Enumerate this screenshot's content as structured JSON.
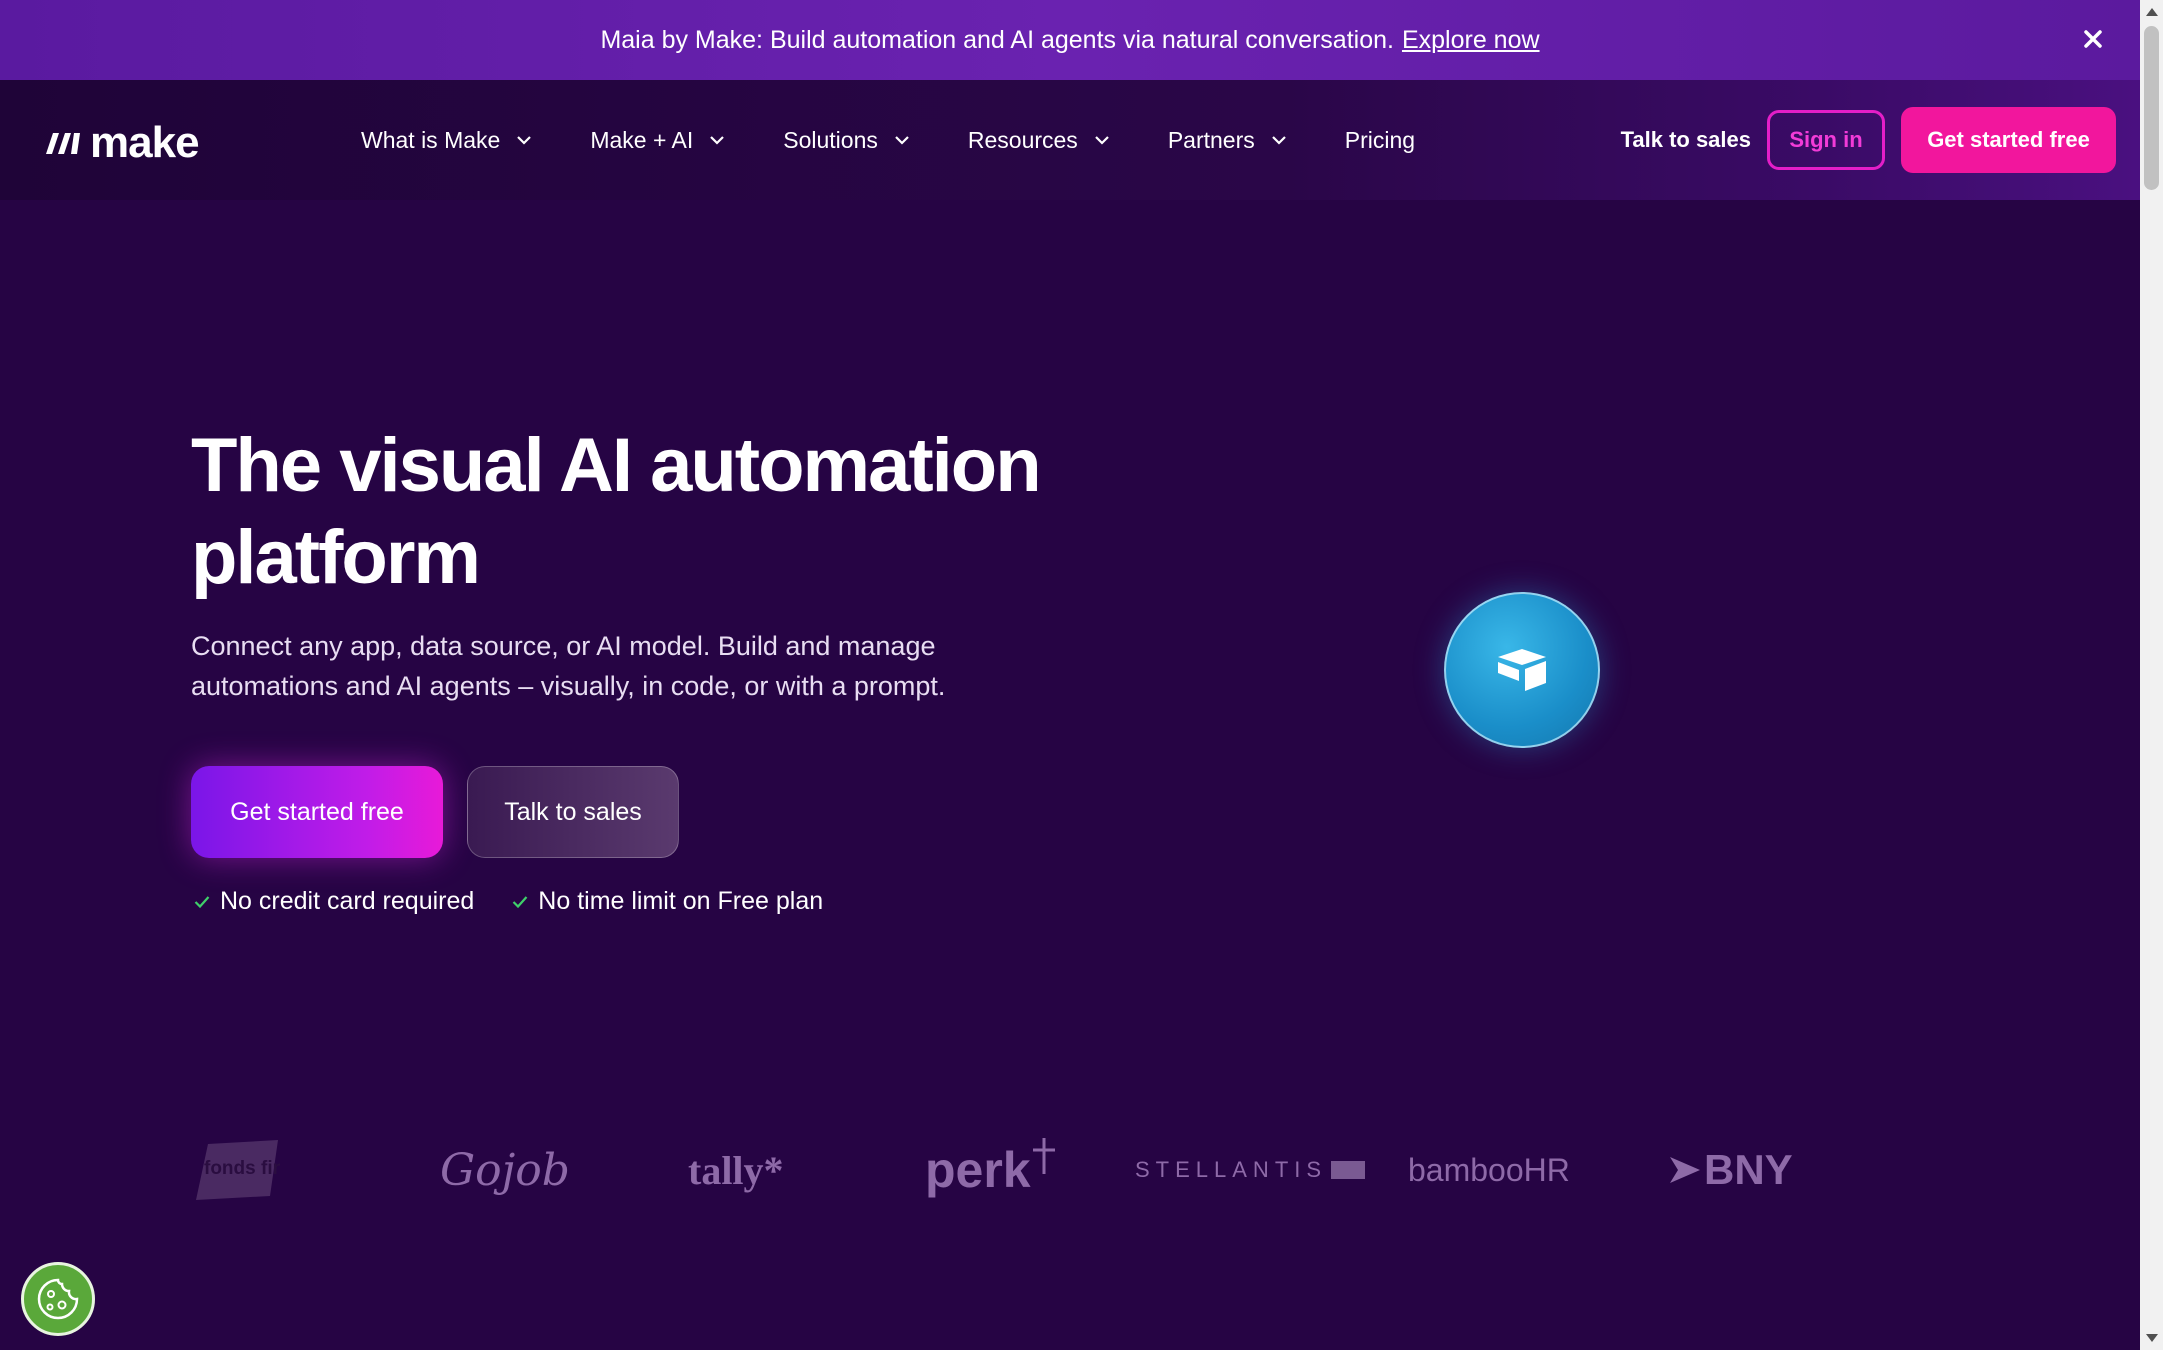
{
  "banner": {
    "text": "Maia by Make: Build automation and AI agents via natural conversation.",
    "link": "Explore now",
    "close_icon": "close-icon"
  },
  "nav": {
    "logo_text": "make",
    "menu": [
      {
        "label": "What is Make"
      },
      {
        "label": "Make + AI"
      },
      {
        "label": "Solutions"
      },
      {
        "label": "Resources"
      },
      {
        "label": "Partners"
      },
      {
        "label": "Pricing"
      }
    ],
    "talk_to_sales": "Talk to sales",
    "sign_in": "Sign in",
    "get_started": "Get started free"
  },
  "hero": {
    "title_line1": "The visual AI automation",
    "title_line2": "platform",
    "subtitle_line1": "Connect any app, data source, or AI model. Build and manage",
    "subtitle_line2": "automations and AI agents – visually, in code, or with a prompt.",
    "cta_primary": "Get started free",
    "cta_secondary": "Talk to sales",
    "checks": [
      "No credit card required",
      "No time limit on Free plan"
    ]
  },
  "customer_logos": [
    "fonds finanz",
    "Gojob",
    "tally*",
    "perk",
    "STELLANTIS",
    "bambooHR",
    "BNY"
  ],
  "icons": {
    "bubble": "airtable-icon",
    "cookie": "cookie-icon"
  },
  "colors": {
    "background": "#260444",
    "banner": "#6a22b0",
    "accent_pink": "#f2169d",
    "sign_in_border": "#e41ec8",
    "check_green": "#3fd06a"
  }
}
